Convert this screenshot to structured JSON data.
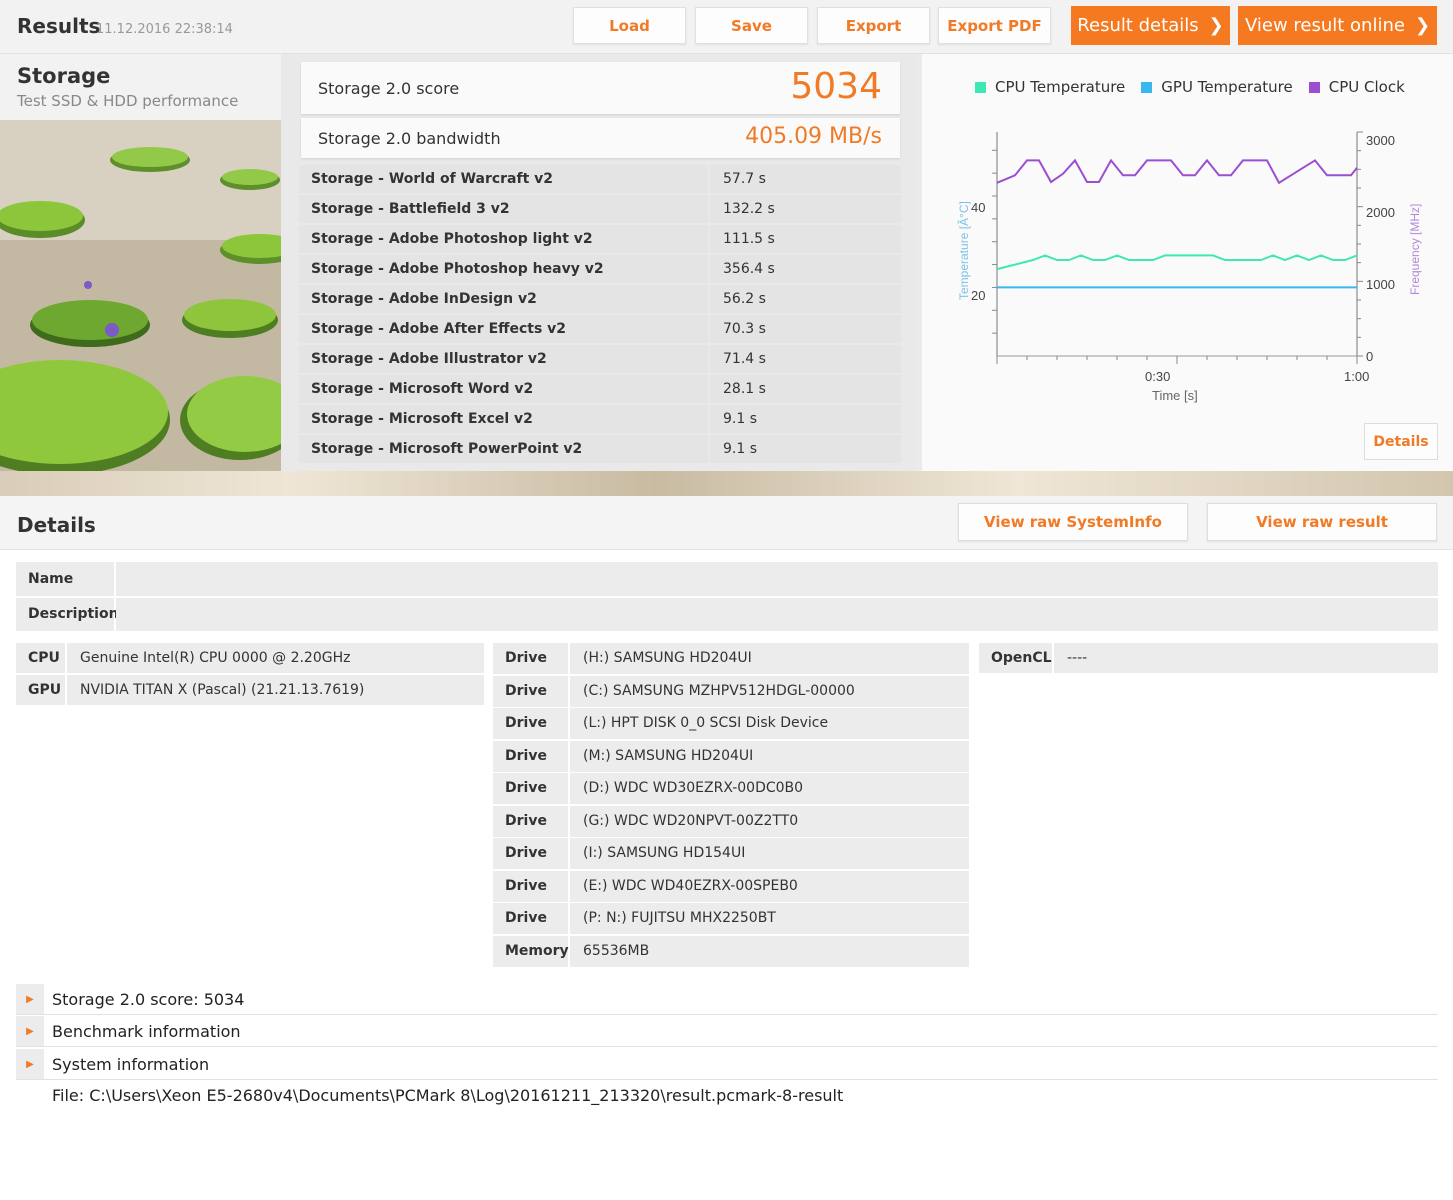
{
  "header": {
    "title": "Results",
    "date": "11.12.2016 22:38:14",
    "buttons": {
      "load": "Load",
      "save": "Save",
      "export": "Export",
      "export_pdf": "Export PDF",
      "result_details": "Result details",
      "view_online": "View result online"
    }
  },
  "test": {
    "title": "Storage",
    "subtitle": "Test SSD & HDD performance"
  },
  "score": {
    "score_label": "Storage 2.0 score",
    "score_value": "5034",
    "bandwidth_label": "Storage 2.0 bandwidth",
    "bandwidth_value": "405.09 MB/s"
  },
  "results": [
    {
      "name": "Storage - World of Warcraft v2",
      "value": "57.7 s"
    },
    {
      "name": "Storage - Battlefield 3 v2",
      "value": "132.2 s"
    },
    {
      "name": "Storage - Adobe Photoshop light v2",
      "value": "111.5 s"
    },
    {
      "name": "Storage - Adobe Photoshop heavy v2",
      "value": "356.4 s"
    },
    {
      "name": "Storage - Adobe InDesign v2",
      "value": "56.2 s"
    },
    {
      "name": "Storage - Adobe After Effects v2",
      "value": "70.3 s"
    },
    {
      "name": "Storage - Adobe Illustrator v2",
      "value": "71.4 s"
    },
    {
      "name": "Storage - Microsoft Word v2",
      "value": "28.1 s"
    },
    {
      "name": "Storage - Microsoft Excel v2",
      "value": "9.1 s"
    },
    {
      "name": "Storage - Microsoft PowerPoint v2",
      "value": "9.1 s"
    }
  ],
  "chart": {
    "legend": [
      {
        "name": "CPU Temperature",
        "color": "#3ee8b5"
      },
      {
        "name": "GPU Temperature",
        "color": "#39b8f0"
      },
      {
        "name": "CPU Clock",
        "color": "#9b4fd0"
      }
    ],
    "left_label": "Temperature [Â°C]",
    "right_label": "Frequency [MHz]",
    "x_label": "Time [s]",
    "left_ticks": [
      "40",
      "20"
    ],
    "right_ticks": [
      "3000",
      "2000",
      "1000",
      "0"
    ],
    "x_ticks": [
      "0:30",
      "1:00"
    ],
    "details_label": "Details"
  },
  "chart_data": {
    "type": "line",
    "xlabel": "Time [s]",
    "ylabel": "Temperature [Â°C]",
    "y2label": "Frequency [MHz]",
    "xlim": [
      0,
      60
    ],
    "ylim": [
      15,
      64
    ],
    "y2lim": [
      0,
      3000
    ],
    "series": [
      {
        "name": "CPU Temperature",
        "axis": "left",
        "x": [
          0,
          3,
          6,
          8,
          10,
          12,
          14,
          16,
          18,
          20,
          22,
          24,
          26,
          28,
          30,
          32,
          34,
          36,
          38,
          40,
          42,
          44,
          46,
          48,
          50,
          52,
          54,
          56,
          58,
          60
        ],
        "values": [
          34,
          35,
          36,
          37,
          36,
          36,
          37,
          36,
          36,
          37,
          36,
          36,
          36,
          37,
          37,
          37,
          37,
          37,
          36,
          36,
          36,
          36,
          37,
          36,
          37,
          36,
          37,
          36,
          36,
          37
        ]
      },
      {
        "name": "GPU Temperature",
        "axis": "left",
        "x": [
          0,
          60
        ],
        "values": [
          30,
          30
        ]
      },
      {
        "name": "CPU Clock",
        "axis": "right",
        "x": [
          0,
          3,
          5,
          7,
          9,
          11,
          13,
          15,
          17,
          19,
          21,
          23,
          25,
          27,
          29,
          31,
          33,
          35,
          37,
          39,
          41,
          43,
          45,
          47,
          49,
          51,
          53,
          55,
          57,
          59,
          60
        ],
        "values": [
          2320,
          2420,
          2620,
          2620,
          2330,
          2440,
          2620,
          2330,
          2330,
          2620,
          2420,
          2420,
          2620,
          2620,
          2620,
          2420,
          2420,
          2620,
          2420,
          2420,
          2620,
          2620,
          2620,
          2320,
          2420,
          2520,
          2620,
          2420,
          2420,
          2420,
          2520
        ]
      }
    ]
  },
  "details": {
    "title": "Details",
    "view_sysinfo": "View raw SystemInfo",
    "view_result": "View raw result",
    "name_label": "Name",
    "name_value": "",
    "description_label": "Description",
    "description_value": "",
    "cpu_label": "CPU",
    "cpu_value": "Genuine Intel(R) CPU 0000 @ 2.20GHz",
    "gpu_label": "GPU",
    "gpu_value": "NVIDIA TITAN X (Pascal) (21.21.13.7619)",
    "drives": [
      {
        "label": "Drive",
        "value": "(H:) SAMSUNG HD204UI"
      },
      {
        "label": "Drive",
        "value": "(C:) SAMSUNG MZHPV512HDGL-00000"
      },
      {
        "label": "Drive",
        "value": "(L:) HPT DISK 0_0 SCSI Disk Device"
      },
      {
        "label": "Drive",
        "value": "(M:) SAMSUNG HD204UI"
      },
      {
        "label": "Drive",
        "value": "(D:) WDC WD30EZRX-00DC0B0"
      },
      {
        "label": "Drive",
        "value": "(G:) WDC WD20NPVT-00Z2TT0"
      },
      {
        "label": "Drive",
        "value": "(I:) SAMSUNG HD154UI"
      },
      {
        "label": "Drive",
        "value": "(E:) WDC WD40EZRX-00SPEB0"
      },
      {
        "label": "Drive",
        "value": "(P: N:) FUJITSU MHX2250BT"
      },
      {
        "label": "Memory",
        "value": "65536MB"
      }
    ],
    "opencl_label": "OpenCL",
    "opencl_value": "----",
    "sections": [
      "Storage 2.0 score: 5034",
      "Benchmark information",
      "System information"
    ],
    "file": "File: C:\\Users\\Xeon E5-2680v4\\Documents\\PCMark 8\\Log\\20161211_213320\\result.pcmark-8-result"
  }
}
